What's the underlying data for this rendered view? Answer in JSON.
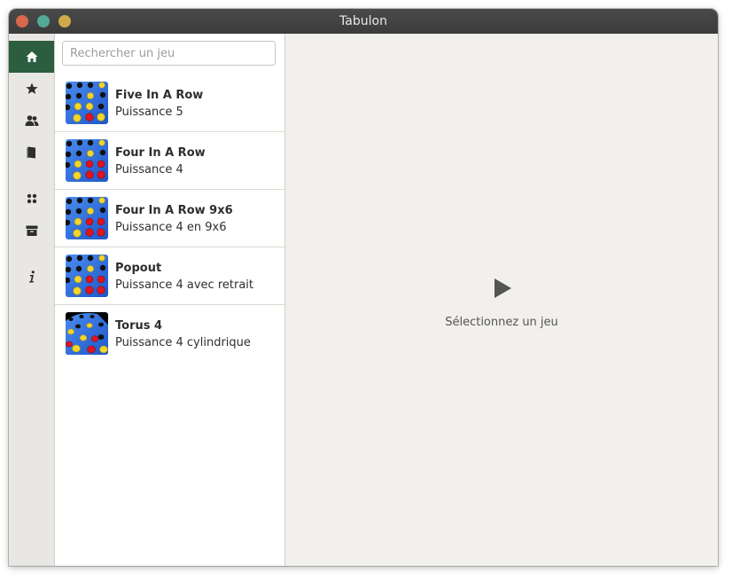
{
  "window": {
    "title": "Tabulon",
    "buttons": [
      {
        "name": "close",
        "color": "#d9674c"
      },
      {
        "name": "minimize",
        "color": "#53a896"
      },
      {
        "name": "maximize",
        "color": "#d1a94a"
      }
    ]
  },
  "sidebar": {
    "active_color": "#2c5d3f",
    "items": [
      {
        "icon": "home-icon",
        "active": true
      },
      {
        "icon": "star-icon",
        "active": false
      },
      {
        "icon": "people-icon",
        "active": false
      },
      {
        "icon": "book-icon",
        "active": false
      },
      {
        "icon": "grid-icon",
        "active": false
      },
      {
        "icon": "archive-icon",
        "active": false
      },
      {
        "icon": "info-icon",
        "active": false
      }
    ]
  },
  "search": {
    "placeholder": "Rechercher un jeu",
    "value": ""
  },
  "games": [
    {
      "title": "Five In A Row",
      "subtitle": "Puissance 5",
      "icon": "connect-board-icon"
    },
    {
      "title": "Four In A Row",
      "subtitle": "Puissance 4",
      "icon": "connect-board-icon"
    },
    {
      "title": "Four In A Row 9x6",
      "subtitle": "Puissance 4 en 9x6",
      "icon": "connect-board-icon"
    },
    {
      "title": "Popout",
      "subtitle": "Puissance 4 avec retrait",
      "icon": "connect-board-icon"
    },
    {
      "title": "Torus 4",
      "subtitle": "Puissance 4 cylindrique",
      "icon": "torus-board-icon"
    }
  ],
  "content": {
    "icon": "play-icon",
    "empty_label": "Sélectionnez un jeu"
  },
  "colors": {
    "board_blue": "#2f6fe0",
    "piece_yellow": "#f2d62a",
    "piece_red": "#e0141e",
    "hole": "#111111"
  }
}
